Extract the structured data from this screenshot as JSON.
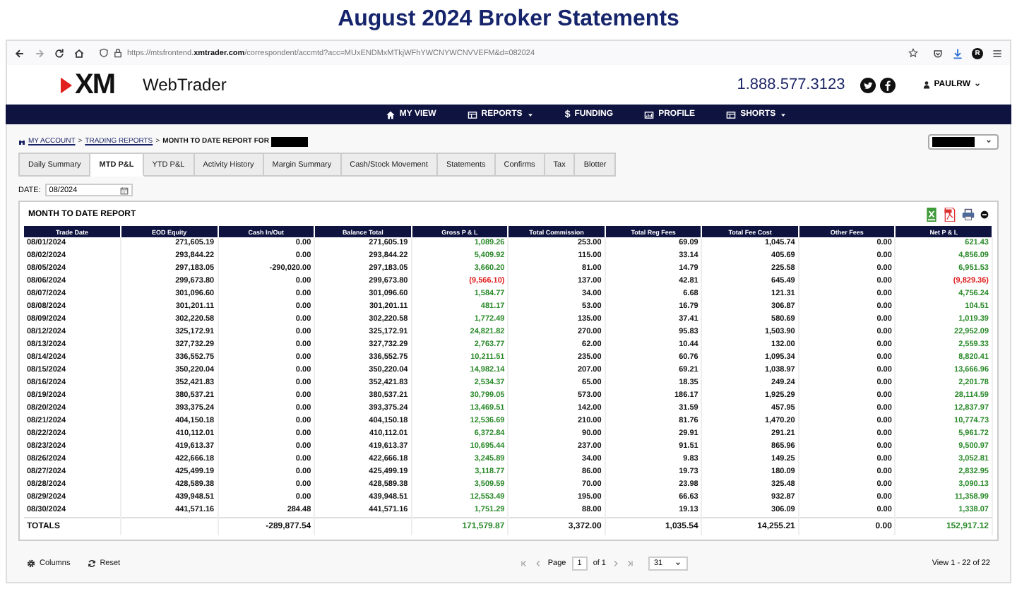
{
  "page_title": "August 2024 Broker Statements",
  "browser": {
    "url": "https://mtsfrontend.**xmtrader.com**/correspondent/accmtd?acc=MUxENDMxMTkjWFhYWCNYWCNVVEFM&d=082024",
    "profile": "R"
  },
  "header": {
    "logo": "XM",
    "app_name": "WebTrader",
    "phone": "1.888.577.3123",
    "user": "PAULRW"
  },
  "nav": [
    {
      "label": "MY VIEW",
      "kind": "home",
      "dropdown": false
    },
    {
      "label": "REPORTS",
      "kind": "table",
      "dropdown": true
    },
    {
      "label": "FUNDING",
      "kind": "symbol",
      "symbol": "$",
      "dropdown": false
    },
    {
      "label": "PROFILE",
      "kind": "chart",
      "dropdown": false
    },
    {
      "label": "SHORTS",
      "kind": "table",
      "dropdown": true
    }
  ],
  "breadcrumb": [
    {
      "kind": "link",
      "label": "MY ACCOUNT"
    },
    {
      "kind": "separator",
      "label": ">"
    },
    {
      "kind": "link",
      "label": "TRADING REPORTS"
    },
    {
      "kind": "separator",
      "label": ">"
    },
    {
      "kind": "current",
      "label": "MONTH TO DATE REPORT FOR"
    }
  ],
  "tabs": [
    {
      "label": "Daily Summary",
      "selected": false
    },
    {
      "label": "MTD P&L",
      "selected": true
    },
    {
      "label": "YTD P&L",
      "selected": false
    },
    {
      "label": "Activity History",
      "selected": false
    },
    {
      "label": "Margin Summary",
      "selected": false
    },
    {
      "label": "Cash/Stock Movement",
      "selected": false
    },
    {
      "label": "Statements",
      "selected": false
    },
    {
      "label": "Confirms",
      "selected": false
    },
    {
      "label": "Tax",
      "selected": false
    },
    {
      "label": "Blotter",
      "selected": false
    }
  ],
  "date_filter": {
    "label": "DATE:",
    "value": "08/2024"
  },
  "report": {
    "title": "MONTH TO DATE REPORT",
    "columns": [
      "Trade Date",
      "EOD Equity",
      "Cash In/Out",
      "Balance Total",
      "Gross P & L",
      "Total Commission",
      "Total Reg Fees",
      "Total Fee Cost",
      "Other Fees",
      "Net P & L"
    ],
    "rows": [
      {
        "loss": false,
        "cells": [
          "08/01/2024",
          "271,605.19",
          "0.00",
          "271,605.19",
          "1,089.26",
          "253.00",
          "69.09",
          "1,045.74",
          "0.00",
          "621.43"
        ]
      },
      {
        "loss": false,
        "cells": [
          "08/02/2024",
          "293,844.22",
          "0.00",
          "293,844.22",
          "5,409.92",
          "115.00",
          "33.14",
          "405.69",
          "0.00",
          "4,856.09"
        ]
      },
      {
        "loss": false,
        "cells": [
          "08/05/2024",
          "297,183.05",
          "-290,020.00",
          "297,183.05",
          "3,660.20",
          "81.00",
          "14.79",
          "225.58",
          "0.00",
          "6,951.53"
        ]
      },
      {
        "loss": true,
        "cells": [
          "08/06/2024",
          "299,673.80",
          "0.00",
          "299,673.80",
          "(9,566.10)",
          "137.00",
          "42.81",
          "645.49",
          "0.00",
          "(9,829.36)"
        ]
      },
      {
        "loss": false,
        "cells": [
          "08/07/2024",
          "301,096.60",
          "0.00",
          "301,096.60",
          "1,584.77",
          "34.00",
          "6.68",
          "121.31",
          "0.00",
          "4,756.24"
        ]
      },
      {
        "loss": false,
        "cells": [
          "08/08/2024",
          "301,201.11",
          "0.00",
          "301,201.11",
          "481.17",
          "53.00",
          "16.79",
          "306.87",
          "0.00",
          "104.51"
        ]
      },
      {
        "loss": false,
        "cells": [
          "08/09/2024",
          "302,220.58",
          "0.00",
          "302,220.58",
          "1,772.49",
          "135.00",
          "37.41",
          "580.69",
          "0.00",
          "1,019.39"
        ]
      },
      {
        "loss": false,
        "cells": [
          "08/12/2024",
          "325,172.91",
          "0.00",
          "325,172.91",
          "24,821.82",
          "270.00",
          "95.83",
          "1,503.90",
          "0.00",
          "22,952.09"
        ]
      },
      {
        "loss": false,
        "cells": [
          "08/13/2024",
          "327,732.29",
          "0.00",
          "327,732.29",
          "2,763.77",
          "62.00",
          "10.44",
          "132.00",
          "0.00",
          "2,559.33"
        ]
      },
      {
        "loss": false,
        "cells": [
          "08/14/2024",
          "336,552.75",
          "0.00",
          "336,552.75",
          "10,211.51",
          "235.00",
          "60.76",
          "1,095.34",
          "0.00",
          "8,820.41"
        ]
      },
      {
        "loss": false,
        "cells": [
          "08/15/2024",
          "350,220.04",
          "0.00",
          "350,220.04",
          "14,982.14",
          "207.00",
          "69.21",
          "1,038.97",
          "0.00",
          "13,666.96"
        ]
      },
      {
        "loss": false,
        "cells": [
          "08/16/2024",
          "352,421.83",
          "0.00",
          "352,421.83",
          "2,534.37",
          "65.00",
          "18.35",
          "249.24",
          "0.00",
          "2,201.78"
        ]
      },
      {
        "loss": false,
        "cells": [
          "08/19/2024",
          "380,537.21",
          "0.00",
          "380,537.21",
          "30,799.05",
          "573.00",
          "186.17",
          "1,925.29",
          "0.00",
          "28,114.59"
        ]
      },
      {
        "loss": false,
        "cells": [
          "08/20/2024",
          "393,375.24",
          "0.00",
          "393,375.24",
          "13,469.51",
          "142.00",
          "31.59",
          "457.95",
          "0.00",
          "12,837.97"
        ]
      },
      {
        "loss": false,
        "cells": [
          "08/21/2024",
          "404,150.18",
          "0.00",
          "404,150.18",
          "12,536.69",
          "210.00",
          "81.76",
          "1,470.20",
          "0.00",
          "10,774.73"
        ]
      },
      {
        "loss": false,
        "cells": [
          "08/22/2024",
          "410,112.01",
          "0.00",
          "410,112.01",
          "6,372.84",
          "90.00",
          "29.91",
          "291.21",
          "0.00",
          "5,961.72"
        ]
      },
      {
        "loss": false,
        "cells": [
          "08/23/2024",
          "419,613.37",
          "0.00",
          "419,613.37",
          "10,695.44",
          "237.00",
          "91.51",
          "865.96",
          "0.00",
          "9,500.97"
        ]
      },
      {
        "loss": false,
        "cells": [
          "08/26/2024",
          "422,666.18",
          "0.00",
          "422,666.18",
          "3,245.89",
          "34.00",
          "9.83",
          "149.25",
          "0.00",
          "3,052.81"
        ]
      },
      {
        "loss": false,
        "cells": [
          "08/27/2024",
          "425,499.19",
          "0.00",
          "425,499.19",
          "3,118.77",
          "86.00",
          "19.73",
          "180.09",
          "0.00",
          "2,832.95"
        ]
      },
      {
        "loss": false,
        "cells": [
          "08/28/2024",
          "428,589.38",
          "0.00",
          "428,589.38",
          "3,509.59",
          "70.00",
          "23.98",
          "325.48",
          "0.00",
          "3,090.13"
        ]
      },
      {
        "loss": false,
        "cells": [
          "08/29/2024",
          "439,948.51",
          "0.00",
          "439,948.51",
          "12,553.49",
          "195.00",
          "66.63",
          "932.87",
          "0.00",
          "11,358.99"
        ]
      },
      {
        "loss": false,
        "cells": [
          "08/30/2024",
          "441,571.16",
          "284.48",
          "441,571.16",
          "1,751.29",
          "88.00",
          "19.13",
          "306.09",
          "0.00",
          "1,338.07"
        ]
      }
    ],
    "totals": {
      "loss": false,
      "cells": [
        "TOTALS",
        null,
        "-289,877.54",
        null,
        "171,579.87",
        "3,372.00",
        "1,035.54",
        "14,255.21",
        "0.00",
        "152,917.12"
      ]
    }
  },
  "footer": {
    "columns": "Columns",
    "reset": "Reset",
    "page_label": "Page",
    "page": "1",
    "of": "of 1",
    "page_size": "31",
    "view": "View 1 - 22 of 22"
  }
}
